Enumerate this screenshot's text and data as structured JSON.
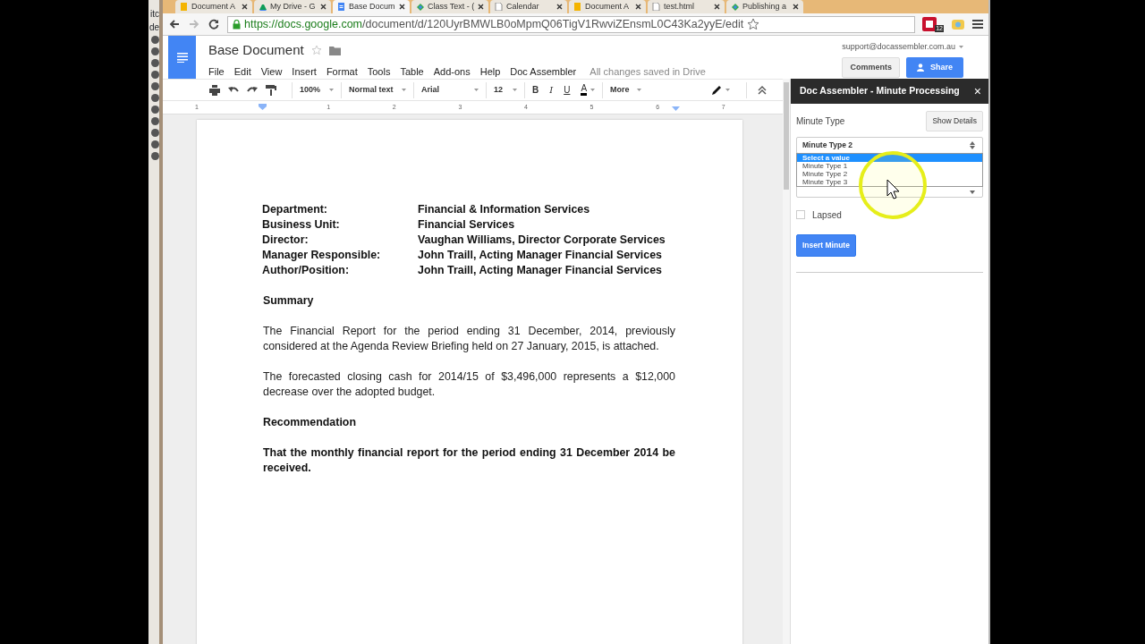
{
  "side_window": {
    "texts": [
      "itc",
      "de"
    ]
  },
  "browser": {
    "tabs": [
      {
        "title": "Document A",
        "kind": "sheet",
        "selected": false
      },
      {
        "title": "My Drive - G",
        "kind": "drive",
        "selected": false
      },
      {
        "title": "Base Docum",
        "kind": "doc",
        "selected": true
      },
      {
        "title": "Class Text - (",
        "kind": "script",
        "selected": false
      },
      {
        "title": "Calendar",
        "kind": "page",
        "selected": false
      },
      {
        "title": "Document A",
        "kind": "sheet",
        "selected": false
      },
      {
        "title": "test.html",
        "kind": "page",
        "selected": false
      },
      {
        "title": "Publishing a",
        "kind": "script",
        "selected": false
      }
    ],
    "url": {
      "host": "https://docs.google.com",
      "path": "/document/d/120UyrBMWLB0oMpmQ06TigV1RwviZEnsmL0C43Ka2yyE/edit"
    },
    "extension_badge": "12"
  },
  "docs": {
    "title": "Base Document",
    "menu": [
      "File",
      "Edit",
      "View",
      "Insert",
      "Format",
      "Tools",
      "Table",
      "Add-ons",
      "Help",
      "Doc Assembler"
    ],
    "save_status": "All changes saved in Drive",
    "account": "support@docassembler.com.au",
    "comments_button": "Comments",
    "share_button": "Share",
    "toolbar": {
      "zoom": "100%",
      "style": "Normal text",
      "font": "Arial",
      "size": "12",
      "bold": "B",
      "italic": "I",
      "underline": "U",
      "text_color": "A",
      "more": "More"
    },
    "ruler": [
      "1",
      "1",
      "2",
      "3",
      "4",
      "5",
      "6",
      "7"
    ]
  },
  "document": {
    "details": [
      {
        "label": "Department:",
        "value": "Financial & Information Services"
      },
      {
        "label": "Business Unit:",
        "value": "Financial Services"
      },
      {
        "label": "Director:",
        "value": "Vaughan Williams, Director Corporate Services"
      },
      {
        "label": "Manager Responsible:",
        "value": "John Traill, Acting Manager Financial Services"
      },
      {
        "label": "Author/Position:",
        "value": "John Traill, Acting Manager Financial Services"
      }
    ],
    "blocks": [
      {
        "kind": "heading",
        "text": "Summary"
      },
      {
        "kind": "paragraph",
        "text": "The Financial Report for the period ending 31 December, 2014, previously considered at the Agenda Review Briefing held on 27 January, 2015, is attached."
      },
      {
        "kind": "paragraph",
        "text": "The forecasted closing cash for 2014/15 of $3,496,000 represents a $12,000 decrease over the adopted budget."
      },
      {
        "kind": "heading",
        "text": "Recommendation"
      },
      {
        "kind": "strong",
        "text": "That the monthly financial report for the period ending 31 December 2014 be received."
      }
    ]
  },
  "sidebar": {
    "title": "Doc Assembler - Minute Processing",
    "close": "×",
    "field_label": "Minute Type",
    "details_button": "Show Details",
    "select_value": "Minute Type 2",
    "options": [
      {
        "label": "Select a value",
        "selected": true
      },
      {
        "label": "Minute Type 1",
        "selected": false
      },
      {
        "label": "Minute Type 2",
        "selected": false
      },
      {
        "label": "Minute Type 3",
        "selected": false
      }
    ],
    "lapsed": {
      "label": "Lapsed",
      "checked": false
    },
    "insert_button": "Insert Minute"
  }
}
